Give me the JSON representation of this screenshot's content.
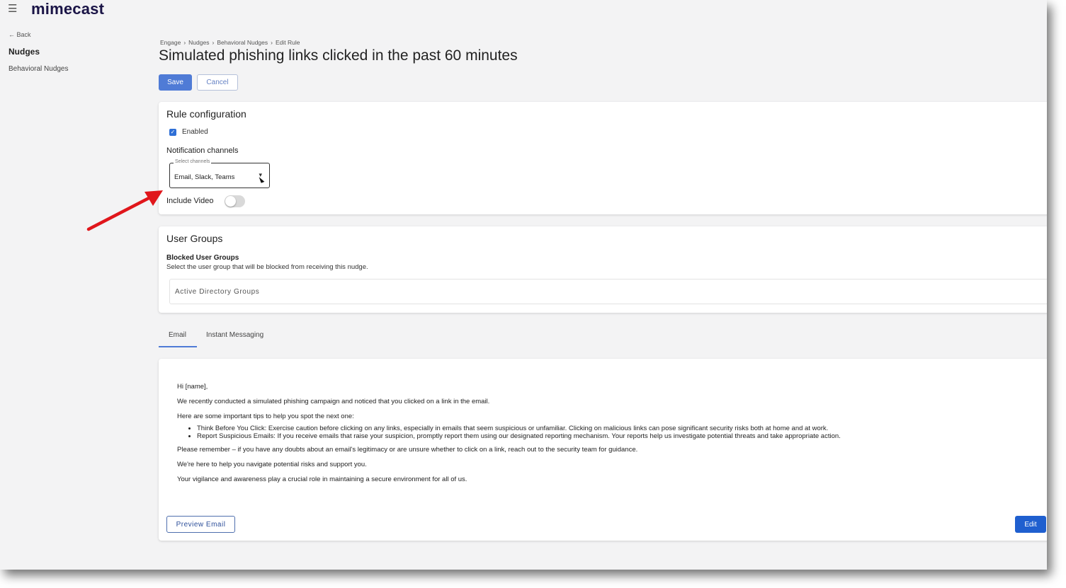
{
  "app": {
    "logo": "mimecast"
  },
  "sidebar": {
    "back_label": "← Back",
    "title": "Nudges",
    "items": [
      {
        "label": "Behavioral Nudges"
      }
    ]
  },
  "breadcrumb": [
    "Engage",
    "Nudges",
    "Behavioral Nudges",
    "Edit Rule"
  ],
  "page": {
    "title": "Simulated phishing links clicked in the past 60 minutes"
  },
  "actions": {
    "save_label": "Save",
    "cancel_label": "Cancel"
  },
  "rule_config": {
    "heading": "Rule configuration",
    "enabled_label": "Enabled",
    "enabled": true,
    "notification_label": "Notification channels",
    "select_legend": "Select channels",
    "select_value": "Email, Slack, Teams",
    "include_video_label": "Include Video",
    "include_video": false
  },
  "user_groups": {
    "heading": "User Groups",
    "blocked_title": "Blocked User Groups",
    "blocked_desc": "Select the user group that will be blocked from receiving this nudge.",
    "ad_placeholder": "Active Directory Groups"
  },
  "tabs": [
    {
      "label": "Email",
      "active": true
    },
    {
      "label": "Instant Messaging",
      "active": false
    }
  ],
  "email": {
    "greeting": "Hi [name],",
    "p1": "We recently conducted a simulated phishing campaign and noticed that you clicked on a link in the email.",
    "p2": "Here are some important tips to help you spot the next one:",
    "tips": [
      "Think Before You Click: Exercise caution before clicking on any links, especially in emails that seem suspicious or unfamiliar. Clicking on malicious links can pose significant security risks both at home and at work.",
      "Report Suspicious Emails: If you receive emails that raise your suspicion, promptly report them using our designated reporting mechanism. Your reports help us investigate potential threats and take appropriate action."
    ],
    "p3": "Please remember – if you have any doubts about an email's legitimacy or are unsure whether to click on a link, reach out to the security team for guidance.",
    "p4": "We're here to help you navigate potential risks and support you.",
    "p5": "Your vigilance and awareness play a crucial role in maintaining a secure environment for all of us.",
    "preview_label": "Preview Email",
    "edit_label": "Edit"
  },
  "colors": {
    "primary": "#4f7bd6",
    "edit_button": "#1f5fcf",
    "annotation_arrow": "#e0161b"
  }
}
